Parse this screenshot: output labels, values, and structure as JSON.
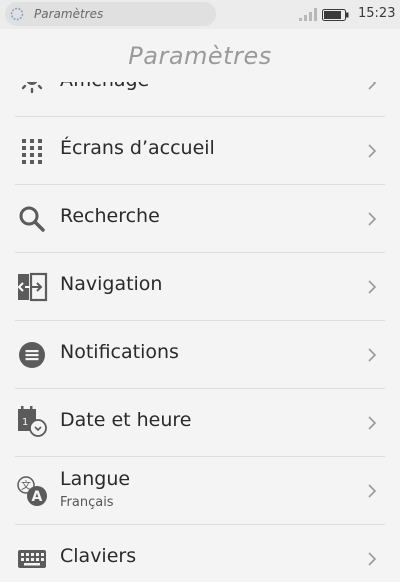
{
  "status_bar": {
    "search_text": "Paramètres",
    "time": "15:23"
  },
  "header": {
    "title": "Paramètres"
  },
  "items": [
    {
      "label": "Affichage",
      "icon": "brightness-icon"
    },
    {
      "label": "Écrans d’accueil",
      "icon": "grid-icon"
    },
    {
      "label": "Recherche",
      "icon": "search-icon"
    },
    {
      "label": "Navigation",
      "icon": "navigation-icon"
    },
    {
      "label": "Notifications",
      "icon": "notifications-icon"
    },
    {
      "label": "Date et heure",
      "icon": "calendar-clock-icon"
    },
    {
      "label": "Langue",
      "sublabel": "Français",
      "icon": "language-icon"
    },
    {
      "label": "Claviers",
      "icon": "keyboard-icon"
    }
  ],
  "colors": {
    "icon": "#5b5b5b",
    "separator": "#dedede",
    "background": "#f4f4f4"
  }
}
